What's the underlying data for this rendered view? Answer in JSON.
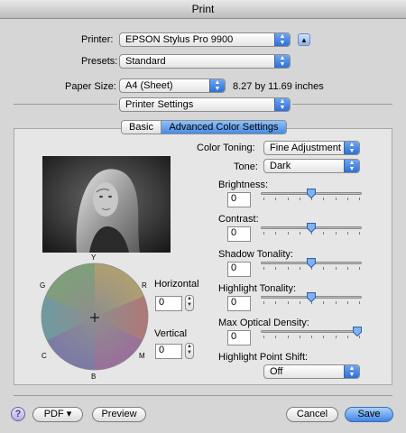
{
  "window": {
    "title": "Print"
  },
  "printer": {
    "label": "Printer:",
    "value": "EPSON Stylus Pro 9900"
  },
  "presets": {
    "label": "Presets:",
    "value": "Standard"
  },
  "paper_size": {
    "label": "Paper Size:",
    "value": "A4 (Sheet)",
    "dimensions": "8.27 by 11.69 inches"
  },
  "section": {
    "value": "Printer Settings"
  },
  "tabs": {
    "basic": "Basic",
    "advanced": "Advanced Color Settings",
    "selected": "Advanced Color Settings"
  },
  "color_toning": {
    "label": "Color Toning:",
    "value": "Fine Adjustment"
  },
  "tone": {
    "label": "Tone:",
    "value": "Dark"
  },
  "sliders": [
    {
      "label": "Brightness:",
      "value": "0",
      "level": 0.5
    },
    {
      "label": "Contrast:",
      "value": "0",
      "level": 0.5
    },
    {
      "label": "Shadow Tonality:",
      "value": "0",
      "level": 0.5
    },
    {
      "label": "Highlight Tonality:",
      "value": "0",
      "level": 0.5
    },
    {
      "label": "Max Optical Density:",
      "value": "0",
      "level": 1.0
    }
  ],
  "highlight_point_shift": {
    "label": "Highlight Point Shift:",
    "value": "Off"
  },
  "color_wheel": {
    "y": "Y",
    "r": "R",
    "m": "M",
    "b": "B",
    "c": "C",
    "g": "G"
  },
  "horizontal": {
    "label": "Horizontal",
    "value": "0"
  },
  "vertical": {
    "label": "Vertical",
    "value": "0"
  },
  "footer": {
    "help": "?",
    "pdf": "PDF ▾",
    "preview": "Preview",
    "cancel": "Cancel",
    "save": "Save"
  },
  "colors": {
    "accent": "#3b7fe0",
    "panel": "#e6e6e6",
    "window": "#d6d6d6"
  }
}
